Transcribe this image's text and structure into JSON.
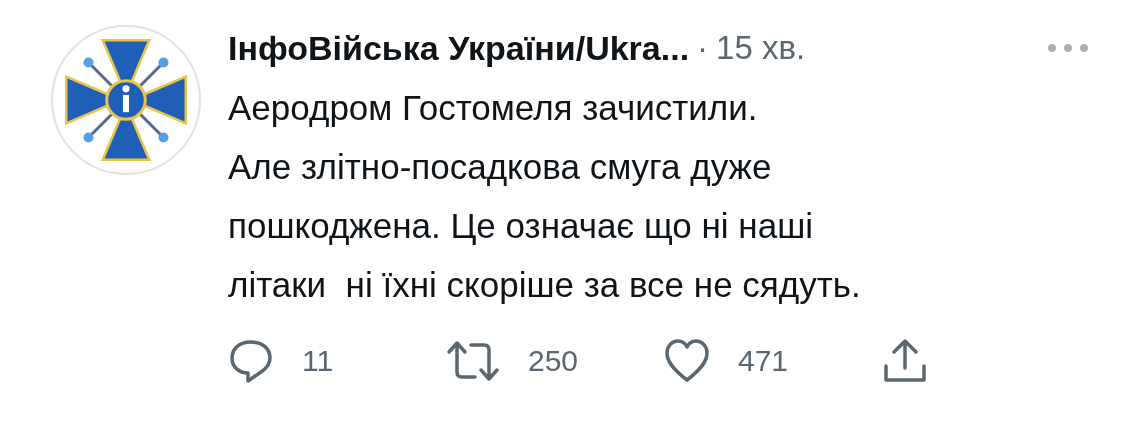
{
  "tweet": {
    "author": "ІнфоВійська України/Ukra...",
    "separator": "·",
    "time": "15 хв.",
    "text": "Аеродром Гостомеля зачистили.\nАле злітно-посадкова смуга дуже\nпошкоджена. Це означає що ні наші\nлітаки  ні їхні скоріше за все не сядуть.",
    "actions": [
      {
        "kind": "reply",
        "count": "11"
      },
      {
        "kind": "retweet",
        "count": "250"
      },
      {
        "kind": "like",
        "count": "471"
      },
      {
        "kind": "share"
      }
    ]
  }
}
